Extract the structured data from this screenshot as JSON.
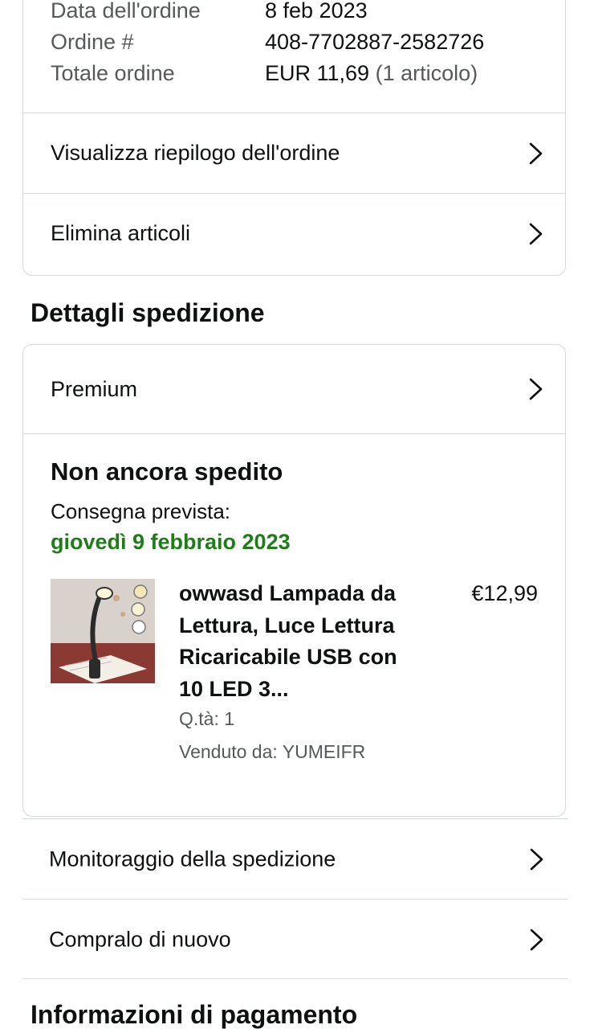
{
  "order_info": {
    "rows": [
      {
        "label": "Data dell'ordine",
        "value": "8 feb 2023",
        "extra": ""
      },
      {
        "label": "Ordine #",
        "value": "408-7702887-2582726",
        "extra": ""
      },
      {
        "label": "Totale ordine",
        "value": "EUR 11,69",
        "extra": "(1 articolo)"
      }
    ],
    "view_summary_label": "Visualizza riepilogo dell'ordine",
    "delete_items_label": "Elimina articoli"
  },
  "shipping": {
    "section_title": "Dettagli spedizione",
    "premium_label": "Premium",
    "status": "Non ancora spedito",
    "expected_label": "Consegna prevista:",
    "expected_date": "giovedì 9 febbraio 2023",
    "product": {
      "title_lines": [
        "owwasd Lampada da",
        "Lettura, Luce Lettura",
        "Ricaricabile USB con",
        "10 LED 3..."
      ],
      "price": "€12,99",
      "qty": "Q.tà: 1",
      "seller": "Venduto da: YUMEIFR"
    }
  },
  "actions": {
    "tracking_label": "Monitoraggio della spedizione",
    "buy_again_label": "Compralo di nuovo"
  },
  "payment": {
    "section_title": "Informazioni di pagamento"
  },
  "colors": {
    "delivery_green": "#1e7d18",
    "border": "#d5d9d9",
    "muted_text": "#565959"
  }
}
